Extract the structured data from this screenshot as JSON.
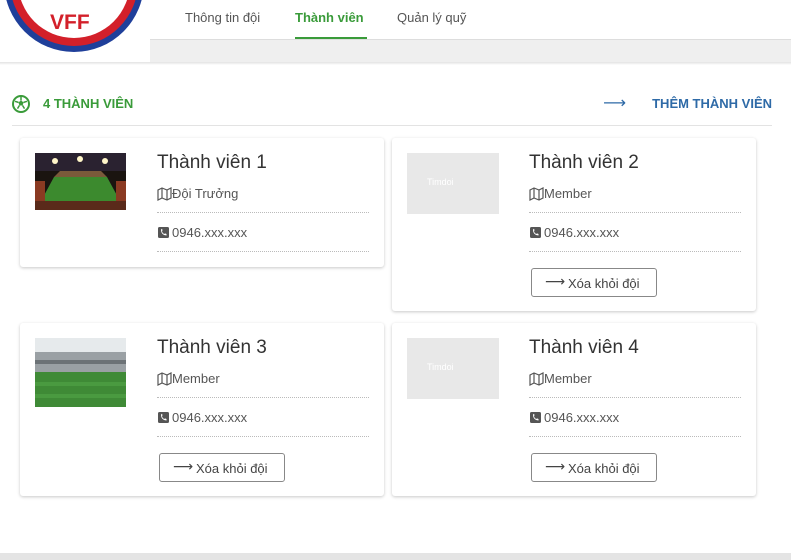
{
  "logo": {
    "text": "VFF"
  },
  "tabs": [
    {
      "label": "Thông tin đội"
    },
    {
      "label": "Thành viên"
    },
    {
      "label": "Quản lý quỹ"
    }
  ],
  "section": {
    "member_count": "4 THÀNH VIÊN",
    "add_member": "THÊM THÀNH VIÊN"
  },
  "members": [
    {
      "name": "Thành viên 1",
      "role": "Đội Trưởng",
      "phone": "0946.xxx.xxx",
      "thumb": "stadium-night-photo"
    },
    {
      "name": "Thành viên 2",
      "role": "Member",
      "phone": "0946.xxx.xxx",
      "remove_label": "Xóa khỏi đội",
      "thumb": "placeholder",
      "watermark": "Timdoi"
    },
    {
      "name": "Thành viên 3",
      "role": "Member",
      "phone": "0946.xxx.xxx",
      "remove_label": "Xóa khỏi đội",
      "thumb": "stadium-day-photo"
    },
    {
      "name": "Thành viên 4",
      "role": "Member",
      "phone": "0946.xxx.xxx",
      "remove_label": "Xóa khỏi đội",
      "thumb": "placeholder",
      "watermark": "Timdoi"
    }
  ],
  "colors": {
    "accent_green": "#3a9b3a",
    "link_blue": "#2e6aa7",
    "brand_red": "#d3202a",
    "brand_blue": "#1f3f9a"
  }
}
